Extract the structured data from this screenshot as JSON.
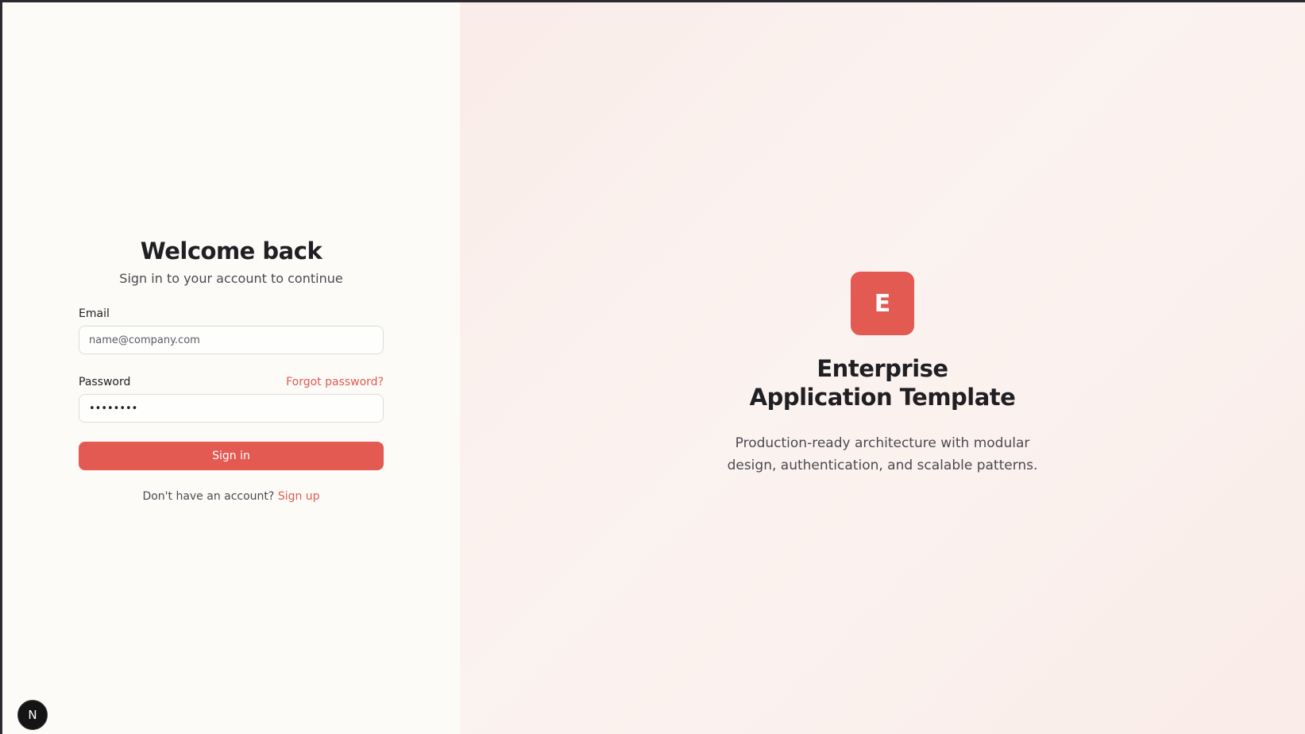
{
  "login": {
    "title": "Welcome back",
    "subtitle": "Sign in to your account to continue",
    "email": {
      "label": "Email",
      "placeholder": "name@company.com",
      "value": ""
    },
    "password": {
      "label": "Password",
      "forgot_label": "Forgot password?",
      "value": "••••••••"
    },
    "submit_label": "Sign in",
    "signup_prompt": "Don't have an account?",
    "signup_label": "Sign up"
  },
  "brand": {
    "logo_letter": "E",
    "title_line1": "Enterprise",
    "title_line2": "Application Template",
    "description": "Production-ready architecture with modular design, authentication, and scalable patterns."
  },
  "dev_badge": {
    "letter": "N",
    "icon": "nextjs-icon"
  },
  "colors": {
    "accent": "#e35a53",
    "left_background": "#fcfbf8",
    "right_background": "#faece8",
    "text_primary": "#1f1f24",
    "text_secondary": "#4a4a52"
  }
}
